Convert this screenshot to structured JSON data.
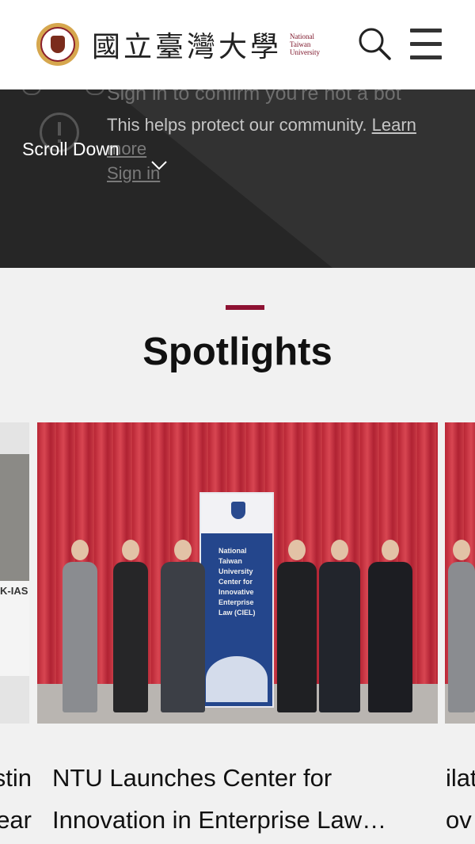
{
  "header": {
    "logo_cn": "國立臺灣大學",
    "logo_en": [
      "National",
      "Taiwan",
      "University"
    ],
    "search_icon": "search-icon",
    "menu_icon": "hamburger-menu-icon"
  },
  "hero": {
    "line1": "Sign in to confirm you're not a bot",
    "line2_text": "This helps protect our community.",
    "line2_link": "Learn",
    "line3": "more",
    "line4": "Sign in",
    "scroll_label": "Scroll Down"
  },
  "section": {
    "title": "Spotlights",
    "accent_color": "#8e1233"
  },
  "cards": {
    "left_sign": "K-IAS",
    "left_caption": [
      "stin",
      "ear"
    ],
    "main_banner": "National Taiwan University Center for Innovative Enterprise Law (CIEL)",
    "main_caption_line1": "NTU Launches Center for",
    "main_caption_line2": "Innovation in Enterprise Law…",
    "right_caption": [
      "ilat",
      "ov"
    ]
  }
}
